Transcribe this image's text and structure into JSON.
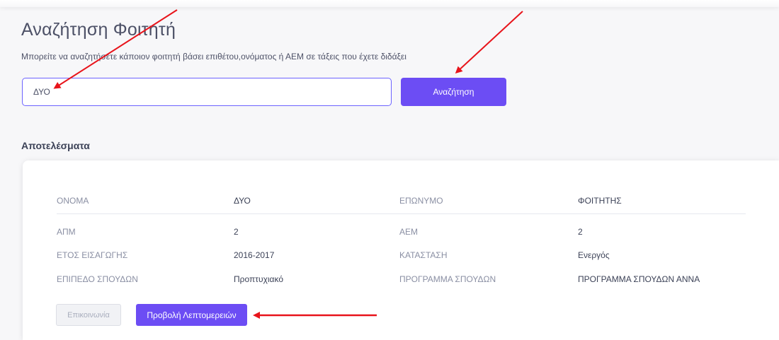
{
  "page": {
    "title": "Αναζήτηση Φοιτητή",
    "subtitle": "Μπορείτε να αναζητήσετε κάποιον φοιτητή βάσει επιθέτου,ονόματος ή ΑΕΜ σε τάξεις που έχετε διδάξει"
  },
  "search": {
    "value": "ΔΥΟ",
    "button_label": "Αναζήτηση"
  },
  "results": {
    "heading": "Αποτελέσματα",
    "fields": {
      "first_name_label": "ΟΝΟΜΑ",
      "first_name_value": "ΔΥΟ",
      "last_name_label": "ΕΠΩΝΥΜΟ",
      "last_name_value": "ΦΟΙΤΗΤΗΣ",
      "apm_label": "ΑΠΜ",
      "apm_value": "2",
      "aem_label": "ΑΕΜ",
      "aem_value": "2",
      "year_label": "ΕΤΟΣ ΕΙΣΑΓΩΓΗΣ",
      "year_value": "2016-2017",
      "status_label": "ΚΑΤΑΣΤΑΣΗ",
      "status_value": "Ενεργός",
      "level_label": "ΕΠΙΠΕΔΟ ΣΠΟΥΔΩΝ",
      "level_value": "Προπτυχιακό",
      "program_label": "ΠΡΟΓΡΑΜΜΑ ΣΠΟΥΔΩΝ",
      "program_value": "ΠΡΟΓΡΑΜΜΑ ΣΠΟΥΔΩΝ ΑΝΝΑ"
    },
    "contact_label": "Επικοινωνία",
    "details_label": "Προβολή Λεπτομερειών"
  },
  "colors": {
    "accent": "#6c4df4",
    "annotation_arrow": "#e8141b"
  }
}
